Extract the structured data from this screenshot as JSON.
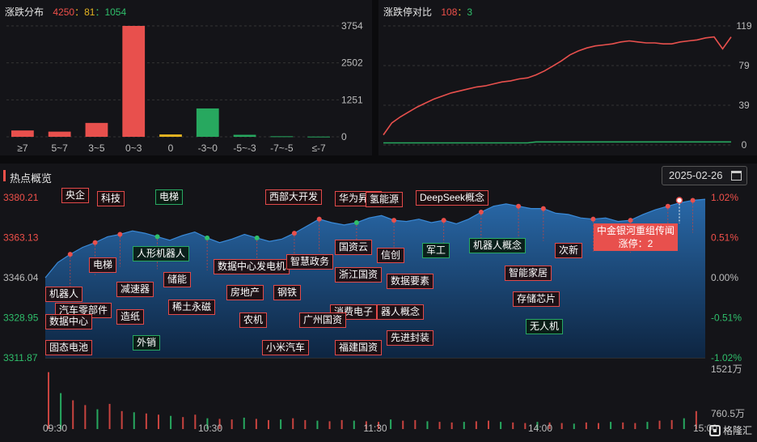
{
  "dist": {
    "title": "涨跌分布",
    "up": "4250",
    "flat": "81",
    "down": "1054",
    "sep": "：",
    "y_ticks": [
      "3754",
      "2502",
      "1251",
      "0"
    ],
    "chart_data": {
      "type": "bar",
      "categories": [
        "≥7",
        "5~7",
        "3~5",
        "0~3",
        "0",
        "-3~0",
        "-5~-3",
        "-7~-5",
        "≤-7"
      ],
      "values": [
        215,
        175,
        470,
        3754,
        81,
        960,
        68,
        18,
        8
      ],
      "ylim": [
        0,
        3754
      ],
      "colors": [
        "#e8504d",
        "#e8504d",
        "#e8504d",
        "#e8504d",
        "#e3b321",
        "#27a85f",
        "#27a85f",
        "#27a85f",
        "#27a85f"
      ]
    }
  },
  "limit": {
    "title": "涨跌停对比",
    "up": "108",
    "down": "3",
    "sep": "：",
    "y_ticks": [
      "119",
      "79",
      "39",
      "0"
    ],
    "chart_data": {
      "type": "line",
      "ylim": [
        0,
        119
      ],
      "series": [
        {
          "color": "#e8504d",
          "values": [
            10,
            22,
            28,
            33,
            38,
            42,
            46,
            49,
            52,
            54,
            56,
            58,
            59,
            61,
            63,
            64,
            66,
            67,
            70,
            74,
            79,
            84,
            90,
            94,
            97,
            99,
            100,
            101,
            103,
            104,
            103,
            102,
            102,
            101,
            101,
            103,
            104,
            105,
            107,
            108,
            96,
            108
          ]
        },
        {
          "color": "#27a85f",
          "values": [
            2,
            2,
            2,
            2,
            2,
            2,
            2,
            2,
            2,
            2,
            2,
            2,
            2,
            2,
            2,
            2,
            2,
            2,
            3,
            3,
            3,
            3,
            3,
            3,
            3,
            3,
            3,
            3,
            3,
            3,
            3,
            3,
            3,
            3,
            3,
            3,
            3,
            3,
            3,
            3,
            3,
            3
          ]
        }
      ]
    }
  },
  "hot": {
    "title": "热点概览",
    "date": "2025-02-26",
    "y_left": [
      "3380.21",
      "3363.13",
      "3346.04",
      "3328.95",
      "3311.87"
    ],
    "y_right": [
      "1.02%",
      "0.51%",
      "0.00%",
      "-0.51%",
      "-1.02%"
    ],
    "vol_ticks": [
      "1521万",
      "760.5万"
    ],
    "x_ticks": [
      "09:30",
      "10:30",
      "11:30",
      "14:00",
      "15:00"
    ],
    "tooltip": {
      "line1": "中金银河重组传闻",
      "line2": "涨停：2"
    },
    "brand": "格隆汇",
    "chart_data": {
      "type": "area",
      "ylim": [
        3311.87,
        3380.21
      ],
      "values": [
        3346.0,
        3352.5,
        3356.0,
        3359.0,
        3361.0,
        3363.5,
        3364.5,
        3366.0,
        3365.0,
        3363.5,
        3362.0,
        3364.0,
        3365.5,
        3363.0,
        3361.0,
        3362.5,
        3364.5,
        3363.0,
        3361.5,
        3362.5,
        3365.0,
        3368.0,
        3371.0,
        3369.5,
        3368.5,
        3369.5,
        3371.5,
        3372.5,
        3370.5,
        3370.0,
        3371.0,
        3369.5,
        3370.5,
        3369.0,
        3371.0,
        3374.0,
        3376.5,
        3377.5,
        3376.5,
        3375.5,
        3375.5,
        3373.5,
        3373.0,
        3371.5,
        3371.0,
        3371.5,
        3370.0,
        3370.5,
        3373.0,
        3375.0,
        3376.5,
        3378.0,
        3379.0,
        3379.5
      ],
      "vol": [
        95,
        60,
        48,
        40,
        33,
        42,
        30,
        28,
        26,
        24,
        22,
        20,
        24,
        18,
        17,
        16,
        19,
        17,
        15,
        16,
        18,
        15,
        14,
        13,
        15,
        14,
        13,
        12,
        16,
        14,
        15,
        13,
        12,
        11,
        12,
        13,
        14,
        12,
        11,
        10,
        12,
        11,
        10,
        9,
        11,
        10,
        12,
        11,
        10,
        12,
        14,
        15,
        18,
        30
      ],
      "vol_max": 100
    },
    "labels": [
      {
        "text": "央企",
        "g": false
      },
      {
        "text": "电梯",
        "g": true
      },
      {
        "text": "西部大开发",
        "g": false
      },
      {
        "text": "华为昇腾",
        "g": false
      },
      {
        "text": "氢能源",
        "g": false
      },
      {
        "text": "DeepSeek概念",
        "g": false
      },
      {
        "text": "科技",
        "g": false
      },
      {
        "text": "电梯",
        "g": false
      },
      {
        "text": "人形机器人",
        "g": true
      },
      {
        "text": "数据中心发电机",
        "g": false
      },
      {
        "text": "智慧政务",
        "g": false
      },
      {
        "text": "国资云",
        "g": false
      },
      {
        "text": "信创",
        "g": false
      },
      {
        "text": "军工",
        "g": true
      },
      {
        "text": "机器人概念",
        "g": true
      },
      {
        "text": "次新",
        "g": false
      },
      {
        "text": "储能",
        "g": false
      },
      {
        "text": "减速器",
        "g": false
      },
      {
        "text": "房地产",
        "g": false
      },
      {
        "text": "钢铁",
        "g": false
      },
      {
        "text": "浙江国资",
        "g": false
      },
      {
        "text": "数据要素",
        "g": false
      },
      {
        "text": "智能家居",
        "g": false
      },
      {
        "text": "机器人",
        "g": false
      },
      {
        "text": "汽车零部件",
        "g": false
      },
      {
        "text": "稀土永磁",
        "g": false
      },
      {
        "text": "消费电子",
        "g": false
      },
      {
        "text": "器人概念",
        "g": false
      },
      {
        "text": "存储芯片",
        "g": false
      },
      {
        "text": "数据中心",
        "g": false
      },
      {
        "text": "造纸",
        "g": false
      },
      {
        "text": "农机",
        "g": false
      },
      {
        "text": "广州国资",
        "g": false
      },
      {
        "text": "无人机",
        "g": true
      },
      {
        "text": "外销",
        "g": true
      },
      {
        "text": "先进封装",
        "g": false
      },
      {
        "text": "固态电池",
        "g": false
      },
      {
        "text": "小米汽车",
        "g": false
      },
      {
        "text": "福建国资",
        "g": false
      }
    ]
  }
}
